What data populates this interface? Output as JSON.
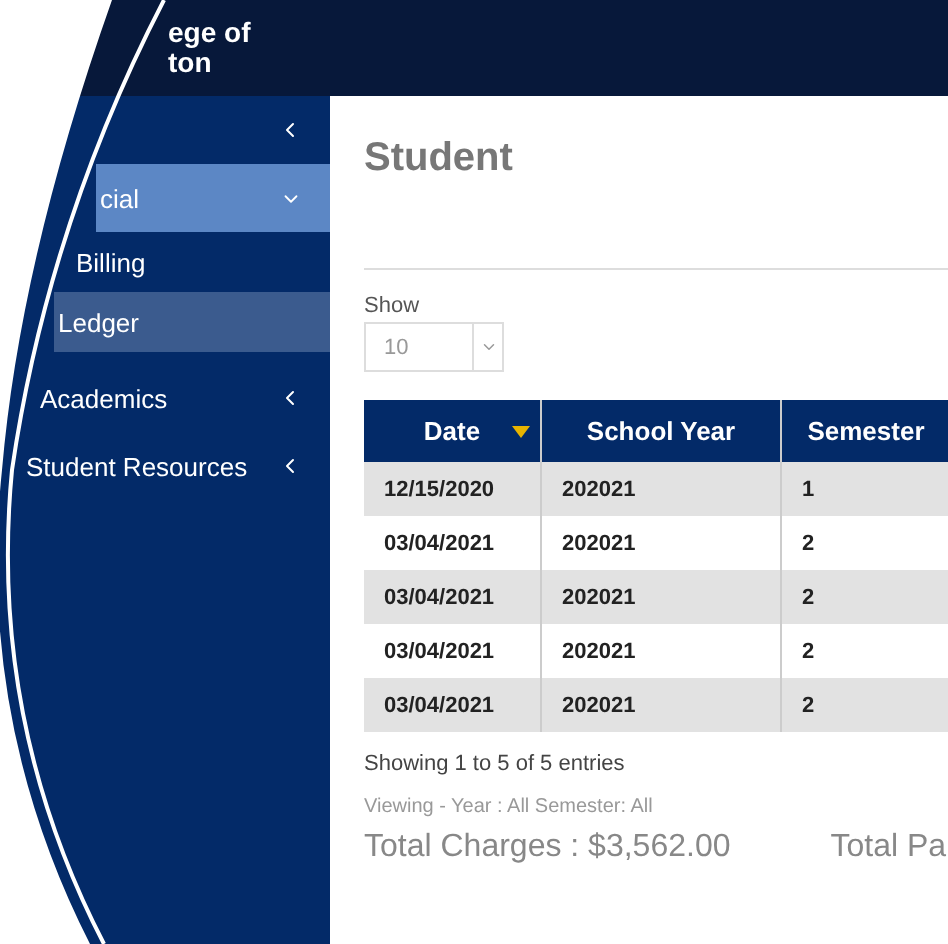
{
  "header": {
    "title_lines": [
      "ege of",
      "ton"
    ]
  },
  "sidebar": {
    "items": [
      {
        "expanded": false,
        "selected": false
      },
      {
        "label": "cial",
        "expanded": true,
        "selected": true,
        "children": [
          {
            "label": "Billing",
            "selected": false
          },
          {
            "label": "Ledger",
            "selected": true
          }
        ]
      },
      {
        "label": "Academics",
        "expanded": false,
        "selected": false
      },
      {
        "label": "Student Resources",
        "expanded": false,
        "selected": false
      }
    ]
  },
  "page": {
    "title": "Student"
  },
  "length": {
    "label": "Show",
    "value": "10"
  },
  "table": {
    "columns": [
      {
        "label": "Date",
        "sorted": true
      },
      {
        "label": "School Year",
        "sorted": false
      },
      {
        "label": "Semester",
        "sorted": false
      }
    ],
    "rows": [
      [
        "12/15/2020",
        "202021",
        "1"
      ],
      [
        "03/04/2021",
        "202021",
        "2"
      ],
      [
        "03/04/2021",
        "202021",
        "2"
      ],
      [
        "03/04/2021",
        "202021",
        "2"
      ],
      [
        "03/04/2021",
        "202021",
        "2"
      ]
    ]
  },
  "info": "Showing 1 to 5 of 5 entries",
  "viewing": "Viewing - Year : All Semester: All",
  "totals": [
    "Total Charges : $3,562.00",
    "Total Pa"
  ]
}
